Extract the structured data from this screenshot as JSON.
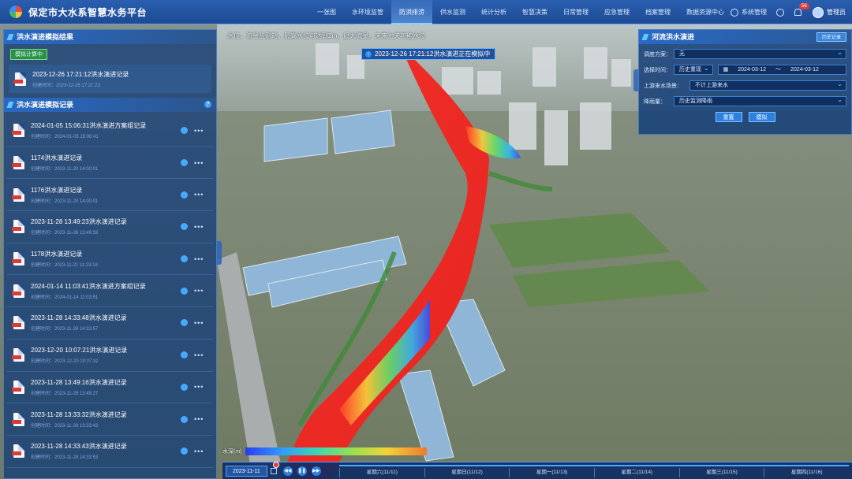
{
  "app": {
    "title": "保定市大水系智慧水务平台"
  },
  "nav": {
    "items": [
      "一张图",
      "水环境监管",
      "防洪排涝",
      "供水监测",
      "统计分析",
      "智慧决策",
      "日常管理",
      "应急管理",
      "档案管理",
      "数据资源中心"
    ],
    "active_index": 2,
    "system_label": "系统管理",
    "notification_count": "56",
    "user_label": "管理员"
  },
  "left_panel": {
    "result_title": "洪水演进模拟结果",
    "status": "模拟计算中",
    "current": {
      "title": "2023-12-26 17:21:12洪水演进记录",
      "time": "创建时间：2023-12-26 17:21:23"
    },
    "records_title": "洪水演进模拟记录",
    "records": [
      {
        "title": "2024-01-05 15:06:31洪水演进方案组记录",
        "time": "创建时间：2024-01-05 15:06:41"
      },
      {
        "title": "1174洪水演进记录",
        "time": "创建时间：2023-11-20 14:00:01"
      },
      {
        "title": "1176洪水演进记录",
        "time": "创建时间：2023-11-20 14:00:01"
      },
      {
        "title": "2023-11-28 13:49:23洪水演进记录",
        "time": "创建时间：2023-11-28 13:49:33"
      },
      {
        "title": "1178洪水演进记录",
        "time": "创建时间：2023-11-21 11:23:18"
      },
      {
        "title": "2024-01-14 11:03:41洪水演进方案组记录",
        "time": "创建时间：2024-01-14 11:03:51"
      },
      {
        "title": "2023-11-28 14:33:48洪水演进记录",
        "time": "创建时间：2023-11-28 14:33:57"
      },
      {
        "title": "2023-12-20 10:07:21洪水演进记录",
        "time": "创建时间：2023-12-20 10:07:32"
      },
      {
        "title": "2023-11-28 13:49:16洪水演进记录",
        "time": "创建时间：2023-11-28 13:49:27"
      },
      {
        "title": "2023-11-28 13:33:32洪水演进记录",
        "time": "创建时间：2023-11-28 13:33:43"
      },
      {
        "title": "2023-11-28 14:33:43洪水演进记录",
        "time": "创建时间：2023-11-28 14:33:53"
      }
    ]
  },
  "tip": "水位、流量监测站，最高水位可达到2m，最大流量。未来七天可能水位",
  "sim_label": "2023-12-26 17:21:12洪水演进正在模拟中",
  "right_panel": {
    "title": "河流洪水演进",
    "history_button": "历史记录",
    "scheme_label": "调度方案：",
    "scheme_value": "无",
    "time_label": "选择时间：",
    "time_type": "历史重现",
    "date_start": "2024-03-12",
    "date_sep": "～",
    "date_end": "2024-03-12",
    "upstream_label": "上游来水场景：",
    "upstream_value": "不计上游来水",
    "rain_label": "降雨量：",
    "rain_value": "历史监测降雨",
    "reset_button": "重置",
    "simulate_button": "模拟"
  },
  "legend": {
    "label": "水深(m)"
  },
  "timeline": {
    "date": "2023-11-11",
    "days": [
      "星期六(11/11)",
      "星期日(11/12)",
      "星期一(11/13)",
      "星期二(11/14)",
      "星期三(11/15)",
      "星期四(11/16)"
    ]
  },
  "colors": {
    "topbar": "#1d4a93",
    "flood_red": "#ee2b24",
    "panel": "#143e78",
    "accent": "#5ec8ff"
  }
}
